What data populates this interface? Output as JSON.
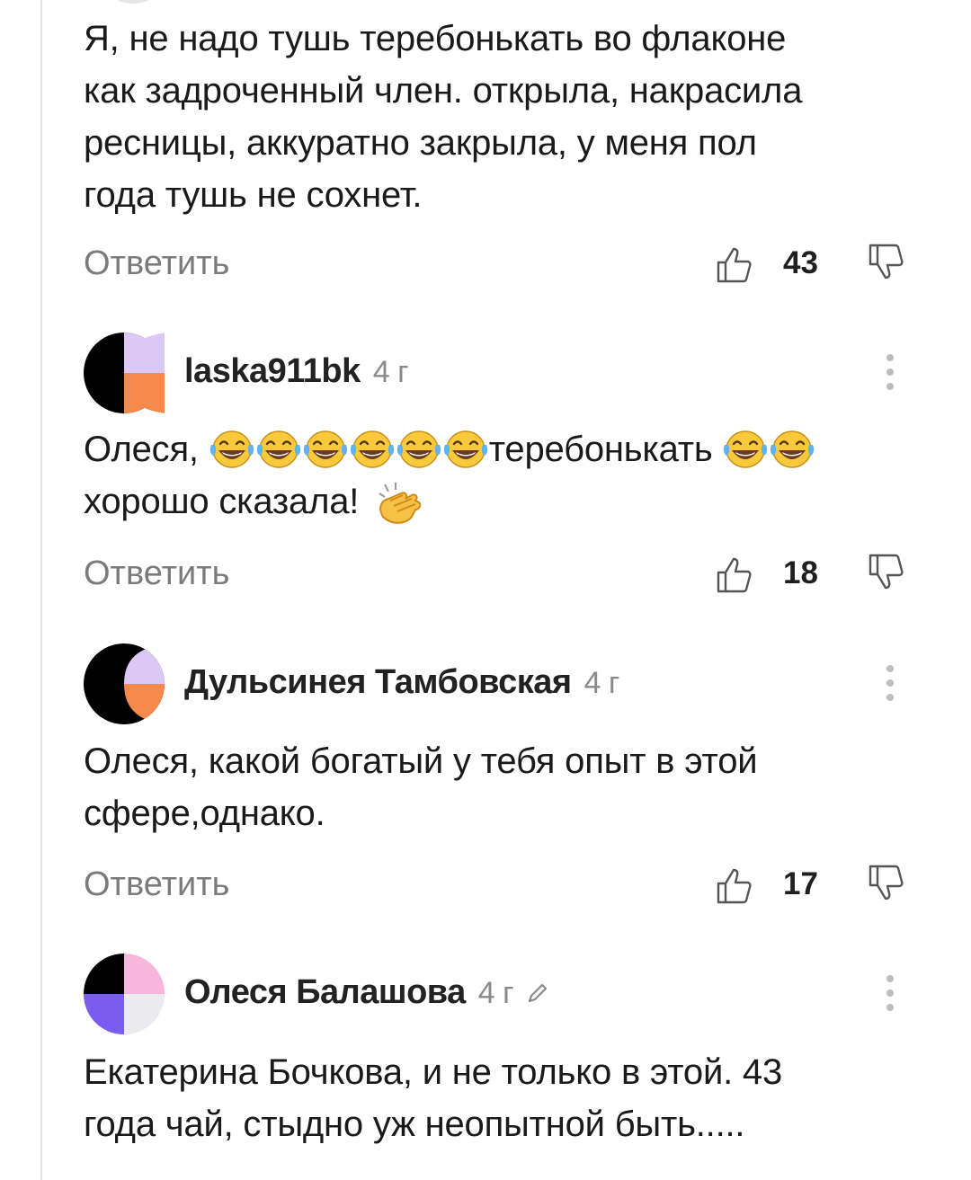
{
  "comments": [
    {
      "text": "Я, не надо тушь теребонькать во флаконе\nкак задроченный член. открыла, накрасила\nресницы, аккуратно закрыла, у меня пол\nгода тушь не сохнет.",
      "reply_label": "Ответить",
      "likes": "43"
    },
    {
      "author": "laska911bk",
      "time": "4 г",
      "text_start": "Олеся, ",
      "text_middle": "теребонькать ",
      "text_end": "\nхорошо сказала! ",
      "reply_label": "Ответить",
      "likes": "18"
    },
    {
      "author": "Дульсинея Тамбовская",
      "time": "4 г",
      "text": "Олеся, какой богатый у тебя опыт в этой\nсфере,однако.",
      "reply_label": "Ответить",
      "likes": "17"
    },
    {
      "author": "Олеся Балашова",
      "time": "4 г",
      "text": "Екатерина Бочкова, и не только в этой. 43\nгода чай, стыдно уж неопытной быть.....",
      "edited": true
    }
  ],
  "icons": {
    "like": "thumbs-up-outline-icon",
    "dislike": "thumbs-down-outline-icon",
    "more": "vertical-ellipsis-icon",
    "edited": "pencil-icon",
    "laughing_emoji": "face-with-tears-of-joy",
    "clapping_emoji": "clapping-hands"
  },
  "colors": {
    "text": "#1a1a1a",
    "secondary": "#7b7b7b",
    "avatar_lilac": "#dcc8f5",
    "avatar_orange": "#f58a4c",
    "avatar_pink": "#f7b6dc",
    "avatar_purple": "#7a5cf0",
    "avatar_grey": "#ececf0"
  }
}
